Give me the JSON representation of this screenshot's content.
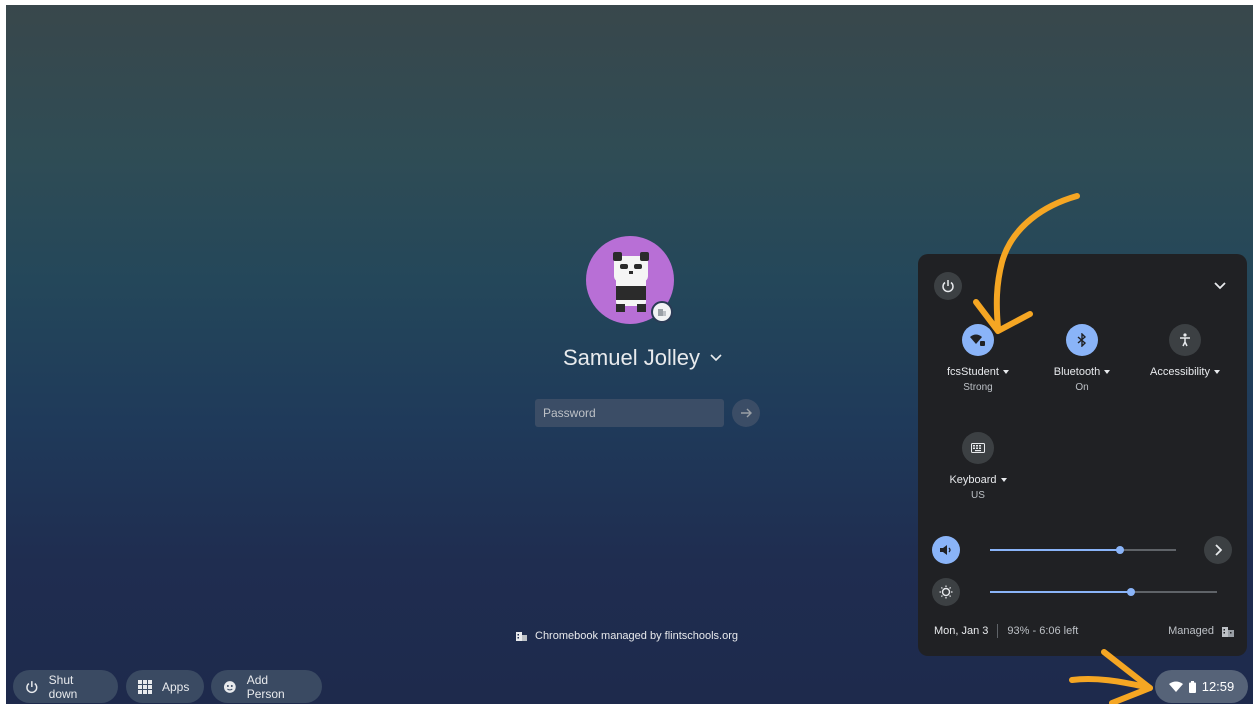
{
  "login": {
    "user_name": "Samuel Jolley",
    "password_placeholder": "Password",
    "managed_note": "Chromebook managed by flintschools.org"
  },
  "shelf": {
    "shutdown_label": "Shut down",
    "apps_label": "Apps",
    "add_person_label": "Add Person",
    "time": "12:59"
  },
  "quick_settings": {
    "tiles": [
      {
        "label": "fcsStudent",
        "sublabel": "Strong",
        "icon": "wifi-icon",
        "active": true
      },
      {
        "label": "Bluetooth",
        "sublabel": "On",
        "icon": "bluetooth-icon",
        "active": true
      },
      {
        "label": "Accessibility",
        "sublabel": "",
        "icon": "accessibility-icon",
        "active": false
      },
      {
        "label": "Keyboard",
        "sublabel": "US",
        "icon": "keyboard-icon",
        "active": false
      }
    ],
    "volume_level": 0.7,
    "brightness_level": 0.62,
    "date": "Mon, Jan 3",
    "battery": "93% - 6:06 left",
    "managed_label": "Managed"
  },
  "colors": {
    "accent": "#8ab4f8",
    "annotation_arrow": "#f5a623",
    "avatar_bg": "#b86fd6",
    "panel_bg": "#202124"
  }
}
